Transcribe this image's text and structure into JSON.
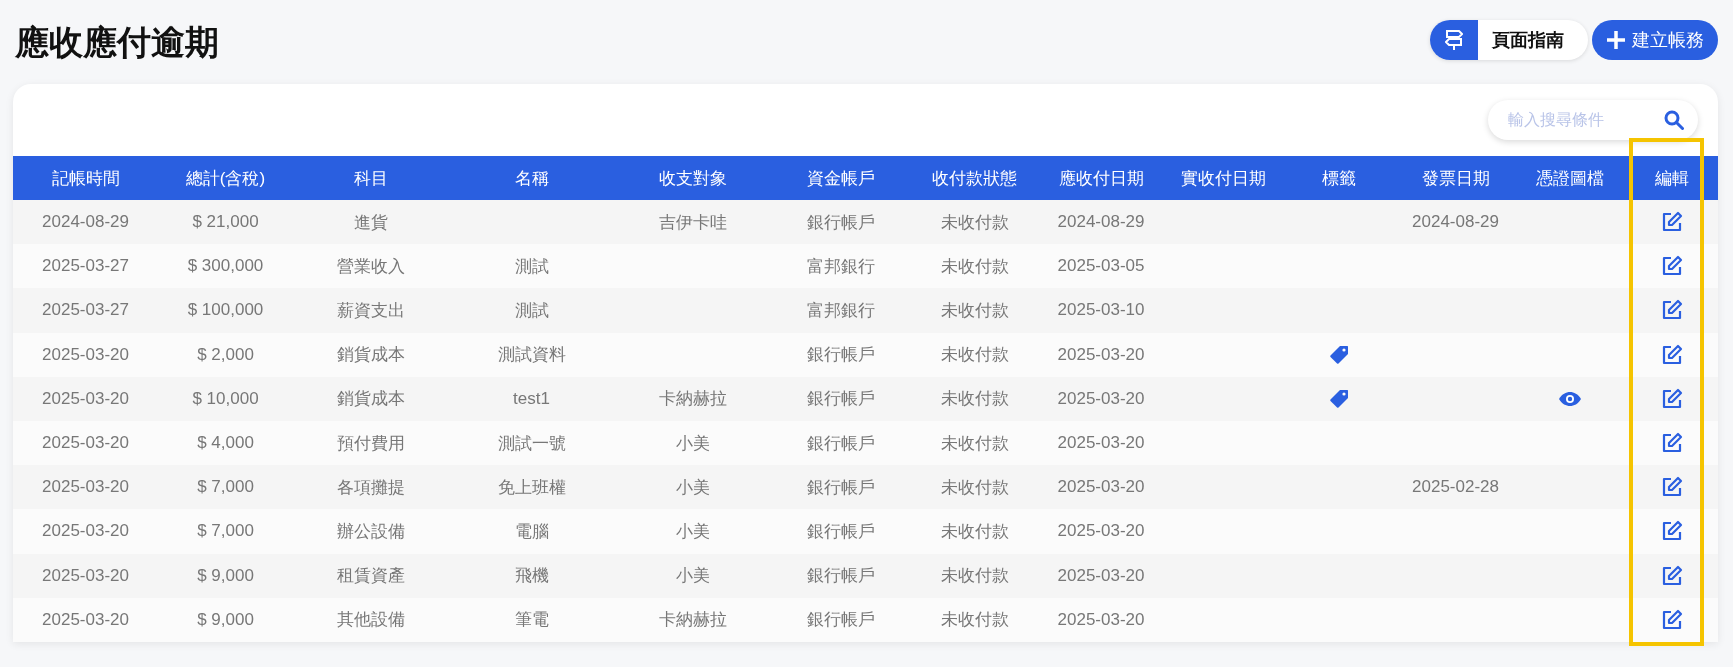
{
  "page": {
    "title": "應收應付逾期"
  },
  "header_buttons": {
    "guide": "頁面指南",
    "create": "建立帳務"
  },
  "search": {
    "placeholder": "輸入搜尋條件"
  },
  "table": {
    "columns": [
      {
        "label": "記帳時間",
        "highlighted": false
      },
      {
        "label": "總計(含稅)",
        "highlighted": false
      },
      {
        "label": "科目",
        "highlighted": false
      },
      {
        "label": "名稱",
        "highlighted": false
      },
      {
        "label": "收支對象",
        "highlighted": false
      },
      {
        "label": "資金帳戶",
        "highlighted": false
      },
      {
        "label": "收付款狀態",
        "highlighted": false
      },
      {
        "label": "應收付日期",
        "highlighted": false
      },
      {
        "label": "實收付日期",
        "highlighted": false
      },
      {
        "label": "標籤",
        "highlighted": false
      },
      {
        "label": "發票日期",
        "highlighted": false
      },
      {
        "label": "憑證圖檔",
        "highlighted": false
      },
      {
        "label": "編輯",
        "highlighted": true
      }
    ],
    "rows": [
      {
        "date": "2024-08-29",
        "total": "$ 21,000",
        "subject": "進貨",
        "party": "吉伊卡哇",
        "account": "銀行帳戶",
        "status": "未收付款",
        "due_date": "2024-08-29",
        "tagged": false,
        "invoice_date": "2024-08-29",
        "has_voucher": false
      },
      {
        "date": "2025-03-27",
        "total": "$ 300,000",
        "subject": "營業收入",
        "name": "測試",
        "account": "富邦銀行",
        "status": "未收付款",
        "due_date": "2025-03-05",
        "tagged": false,
        "has_voucher": false
      },
      {
        "date": "2025-03-27",
        "total": "$ 100,000",
        "subject": "薪資支出",
        "name": "測試",
        "account": "富邦銀行",
        "status": "未收付款",
        "due_date": "2025-03-10",
        "tagged": false,
        "has_voucher": false
      },
      {
        "date": "2025-03-20",
        "total": "$ 2,000",
        "subject": "銷貨成本",
        "name": "測試資料",
        "account": "銀行帳戶",
        "status": "未收付款",
        "due_date": "2025-03-20",
        "tagged": true,
        "has_voucher": false
      },
      {
        "date": "2025-03-20",
        "total": "$ 10,000",
        "subject": "銷貨成本",
        "name": "test1",
        "party": "卡納赫拉",
        "account": "銀行帳戶",
        "status": "未收付款",
        "due_date": "2025-03-20",
        "tagged": true,
        "has_voucher": true
      },
      {
        "date": "2025-03-20",
        "total": "$ 4,000",
        "subject": "預付費用",
        "name": "測試一號",
        "party": "小美",
        "account": "銀行帳戶",
        "status": "未收付款",
        "due_date": "2025-03-20",
        "tagged": false,
        "has_voucher": false
      },
      {
        "date": "2025-03-20",
        "total": "$ 7,000",
        "subject": "各項攤提",
        "name": "免上班權",
        "party": "小美",
        "account": "銀行帳戶",
        "status": "未收付款",
        "due_date": "2025-03-20",
        "tagged": false,
        "invoice_date": "2025-02-28",
        "has_voucher": false
      },
      {
        "date": "2025-03-20",
        "total": "$ 7,000",
        "subject": "辦公設備",
        "name": "電腦",
        "party": "小美",
        "account": "銀行帳戶",
        "status": "未收付款",
        "due_date": "2025-03-20",
        "tagged": false,
        "has_voucher": false
      },
      {
        "date": "2025-03-20",
        "total": "$ 9,000",
        "subject": "租賃資產",
        "name": "飛機",
        "party": "小美",
        "account": "銀行帳戶",
        "status": "未收付款",
        "due_date": "2025-03-20",
        "tagged": false,
        "has_voucher": false
      },
      {
        "date": "2025-03-20",
        "total": "$ 9,000",
        "subject": "其他設備",
        "name": "筆電",
        "party": "卡納赫拉",
        "account": "銀行帳戶",
        "status": "未收付款",
        "due_date": "2025-03-20",
        "tagged": false,
        "has_voucher": false
      }
    ]
  }
}
